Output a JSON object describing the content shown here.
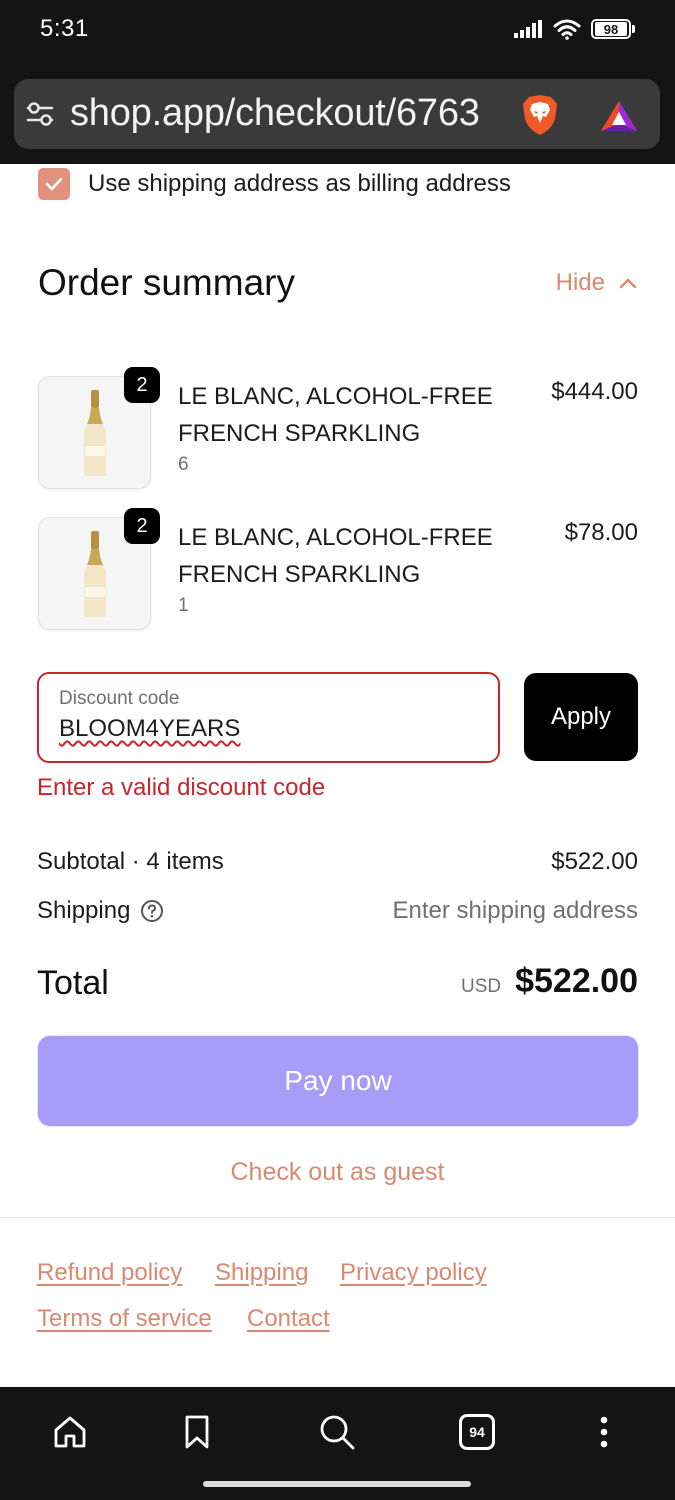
{
  "status_bar": {
    "time": "5:31",
    "battery": "98"
  },
  "browser": {
    "url": "shop.app/checkout/6763",
    "tab_count": "94"
  },
  "billing": {
    "checkbox_checked": true,
    "label": "Use shipping address as billing address"
  },
  "order_summary": {
    "title": "Order summary",
    "toggle_label": "Hide",
    "items": [
      {
        "quantity_badge": "2",
        "name": "LE BLANC, ALCOHOL-FREE FRENCH SPARKLING",
        "variant": "6",
        "price": "$444.00"
      },
      {
        "quantity_badge": "2",
        "name": "LE BLANC, ALCOHOL-FREE FRENCH SPARKLING",
        "variant": "1",
        "price": "$78.00"
      }
    ]
  },
  "discount": {
    "label": "Discount code",
    "value": "BLOOM4YEARS",
    "apply_label": "Apply",
    "error": "Enter a valid discount code"
  },
  "totals": {
    "subtotal_label": "Subtotal · 4 items",
    "subtotal_value": "$522.00",
    "shipping_label": "Shipping",
    "shipping_value": "Enter shipping address",
    "total_label": "Total",
    "currency": "USD",
    "total_value": "$522.00"
  },
  "actions": {
    "pay_label": "Pay now",
    "guest_label": "Check out as guest"
  },
  "footer": {
    "links": [
      "Refund policy",
      "Shipping",
      "Privacy policy",
      "Terms of service",
      "Contact"
    ]
  },
  "colors": {
    "accent": "#d9896f",
    "error": "#c8252c",
    "pay_button": "#a99cf8",
    "checkbox": "#e2917e"
  }
}
